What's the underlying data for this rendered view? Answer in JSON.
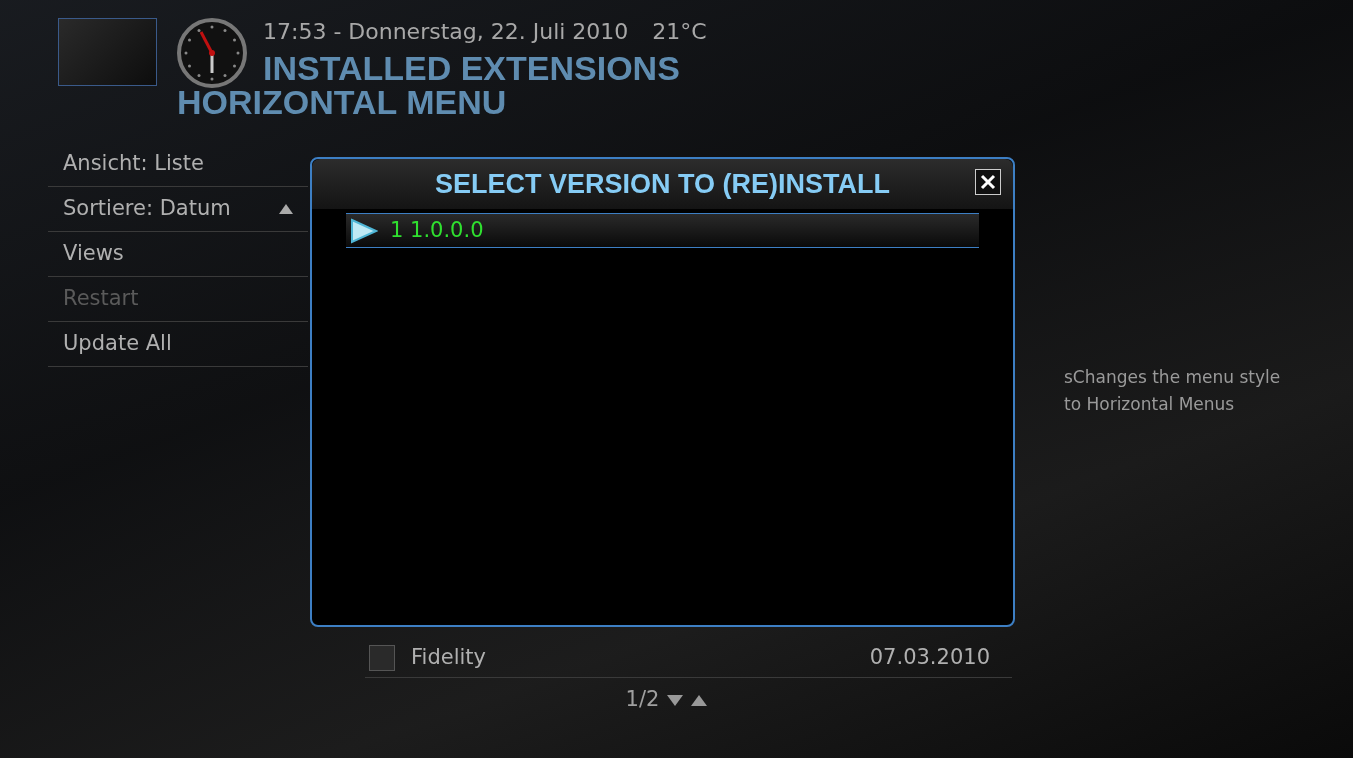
{
  "header": {
    "datetime": "17:53 - Donnerstag, 22. Juli 2010",
    "temperature": "21°C",
    "title": "INSTALLED EXTENSIONS",
    "subtitle": "HORIZONTAL MENU"
  },
  "menu": [
    {
      "label": "Ansicht: Liste",
      "disabled": false,
      "sort_arrow": false
    },
    {
      "label": "Sortiere: Datum",
      "disabled": false,
      "sort_arrow": true
    },
    {
      "label": "Views",
      "disabled": false,
      "sort_arrow": false
    },
    {
      "label": "Restart",
      "disabled": true,
      "sort_arrow": false
    },
    {
      "label": "Update All",
      "disabled": false,
      "sort_arrow": false
    }
  ],
  "extensions": [
    {
      "name": "Fidelity",
      "date": "07.03.2010"
    }
  ],
  "pager": {
    "text": "1/2"
  },
  "description": "sChanges the menu style to Horizontal Menus",
  "dialog": {
    "title": "SELECT VERSION TO (RE)INSTALL",
    "versions": [
      {
        "label": "1 1.0.0.0",
        "selected": true
      }
    ]
  }
}
